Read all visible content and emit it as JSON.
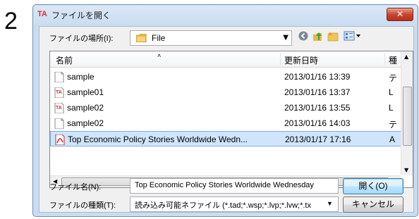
{
  "step_number": "2",
  "dialog": {
    "title": "ファイルを開く",
    "app_icon_text": "TA",
    "close_glyph": "✕"
  },
  "lookin": {
    "label": "ファイルの場所(I):",
    "value": "File"
  },
  "columns": {
    "name": "名前",
    "date": "更新日時",
    "type": "種"
  },
  "files": [
    {
      "name": "sample",
      "date": "2013/01/16 13:39",
      "type": "テ",
      "icon": "text-file-icon"
    },
    {
      "name": "sample01",
      "date": "2013/01/16 13:37",
      "type": "L",
      "icon": "ta-file-icon"
    },
    {
      "name": "sample02",
      "date": "2013/01/16 13:55",
      "type": "L",
      "icon": "ta-file-icon"
    },
    {
      "name": "sample02",
      "date": "2013/01/16 14:03",
      "type": "テ",
      "icon": "text-file-icon"
    },
    {
      "name": "Top Economic Policy Stories Worldwide Wedn...",
      "date": "2013/01/17 17:16",
      "type": "A",
      "icon": "pdf-file-icon",
      "selected": true
    }
  ],
  "filename": {
    "label": "ファイル名(N):",
    "value": "Top Economic Policy Stories Worldwide Wednesday"
  },
  "filetype": {
    "label": "ファイルの種類(T):",
    "value": "読み込み可能ネファイル (*.tad;*.wsp;*.lvp;*.lvw;*.tx"
  },
  "buttons": {
    "open": "開く(O)",
    "cancel": "キャンセル"
  }
}
